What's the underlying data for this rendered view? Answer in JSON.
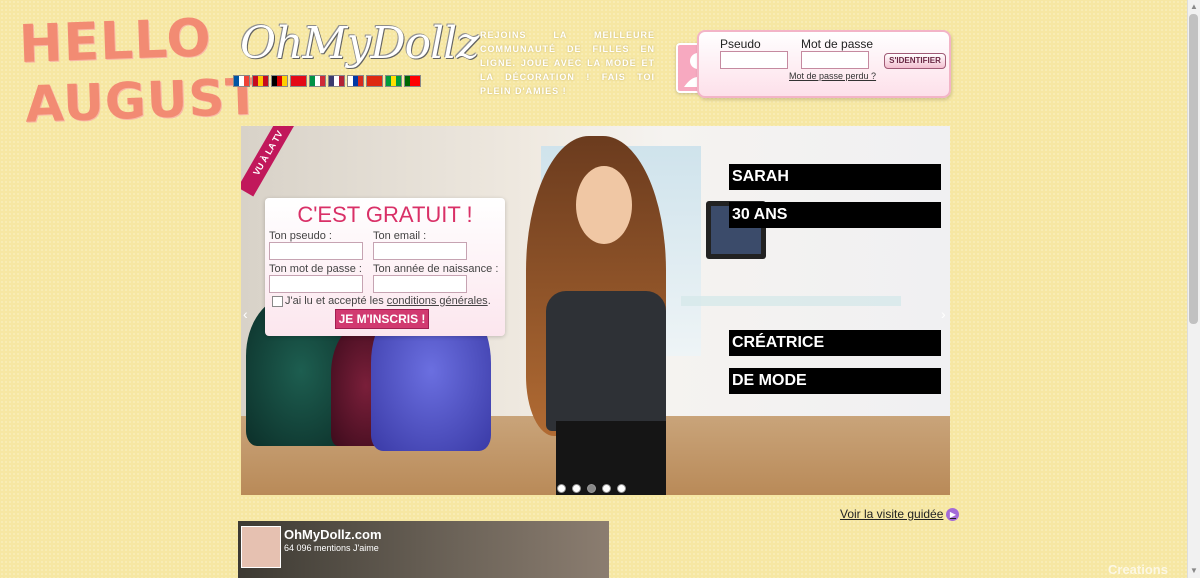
{
  "decor": {
    "line1": "HELLO",
    "line2": "AUGUST"
  },
  "header": {
    "logo": "OhMyDollz",
    "tagline": "Rejoins la meilleure communauté de filles en ligne. Joue avec la mode et la décoration ! Fais toi plein d'amies !",
    "flags": [
      {
        "name": "fr-flag",
        "c": [
          "#0055a4",
          "#ffffff",
          "#ef4135"
        ]
      },
      {
        "name": "es-flag",
        "c": [
          "#c60b1e",
          "#ffc400",
          "#c60b1e"
        ]
      },
      {
        "name": "de-flag",
        "c": [
          "#000000",
          "#dd0000",
          "#ffce00"
        ]
      },
      {
        "name": "tr-flag",
        "c": [
          "#e30a17",
          "#e30a17",
          "#e30a17"
        ]
      },
      {
        "name": "it-flag",
        "c": [
          "#009246",
          "#ffffff",
          "#ce2b37"
        ]
      },
      {
        "name": "us-flag",
        "c": [
          "#3c3b6e",
          "#ffffff",
          "#b22234"
        ]
      },
      {
        "name": "ru-flag",
        "c": [
          "#ffffff",
          "#0039a6",
          "#d52b1e"
        ]
      },
      {
        "name": "cn-flag",
        "c": [
          "#de2910",
          "#de2910",
          "#de2910"
        ]
      },
      {
        "name": "br-flag",
        "c": [
          "#009c3b",
          "#ffdf00",
          "#009c3b"
        ]
      },
      {
        "name": "pt-flag",
        "c": [
          "#006600",
          "#ff0000",
          "#ff0000"
        ]
      }
    ]
  },
  "login": {
    "pseudo_label": "Pseudo",
    "password_label": "Mot de passe",
    "submit": "S'IDENTIFIER",
    "lost_password": "Mot de passe perdu ?"
  },
  "banner": {
    "ribbon": "VU À LA TV",
    "bars": [
      "SARAH",
      "30 ANS",
      "CRÉATRICE",
      "DE MODE"
    ]
  },
  "signup": {
    "title": "C'EST GRATUIT !",
    "pseudo_label": "Ton pseudo :",
    "email_label": "Ton email :",
    "password_label": "Ton mot de passe :",
    "birthyear_label": "Ton année de naissance :",
    "terms_prefix": "J'ai lu et accepté les ",
    "terms_link": "conditions générales",
    "terms_suffix": ".",
    "submit": "JE M'INSCRIS !"
  },
  "tour": {
    "label": "Voir la visite guidée"
  },
  "facebook": {
    "page_name": "OhMyDollz.com",
    "likes": "64 096 mentions J'aime"
  },
  "footer": {
    "credit": "Creations"
  }
}
